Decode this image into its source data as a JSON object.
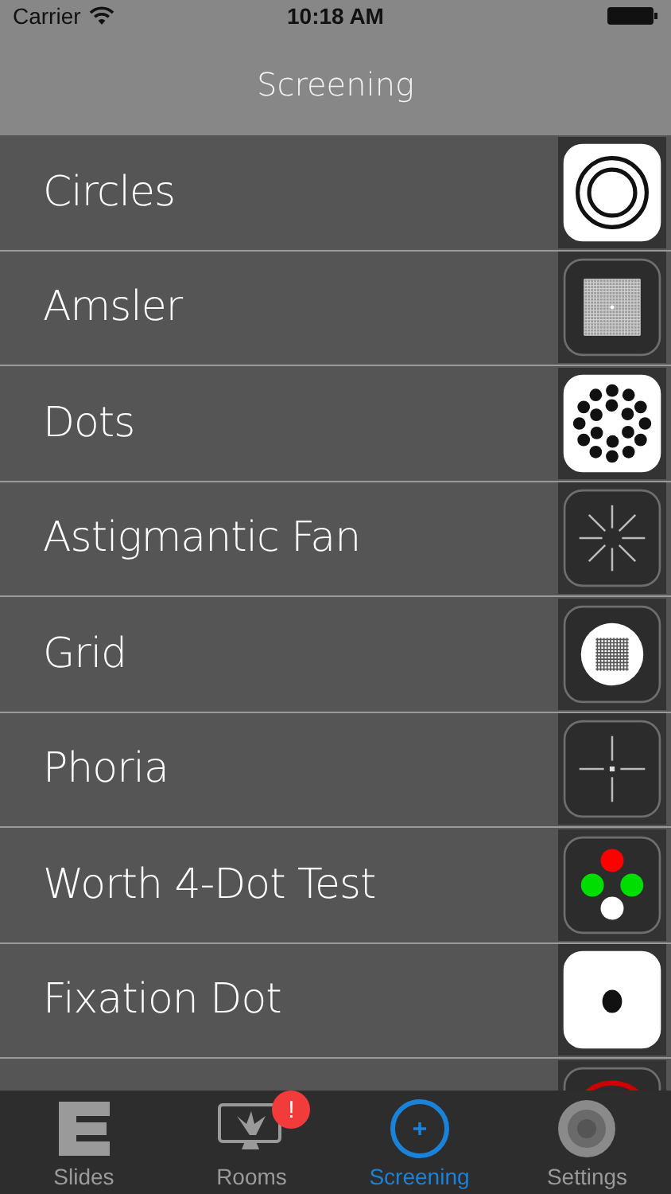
{
  "status_bar": {
    "carrier": "Carrier",
    "time": "10:18 AM"
  },
  "nav": {
    "title": "Screening"
  },
  "rows": [
    {
      "label": "Circles",
      "kind": "circles"
    },
    {
      "label": "Amsler",
      "kind": "amsler"
    },
    {
      "label": "Dots",
      "kind": "dots"
    },
    {
      "label": "Astigmantic Fan",
      "kind": "fan"
    },
    {
      "label": "Grid",
      "kind": "grid"
    },
    {
      "label": "Phoria",
      "kind": "phoria"
    },
    {
      "label": "Worth 4-Dot Test",
      "kind": "worth"
    },
    {
      "label": "Fixation Dot",
      "kind": "fixation"
    },
    {
      "kind": "rings"
    }
  ],
  "tabs": [
    {
      "label": "Slides",
      "kind": "slides",
      "selected": false
    },
    {
      "label": "Rooms",
      "kind": "monitor",
      "selected": false,
      "badge": "!"
    },
    {
      "label": "Screening",
      "kind": "plus",
      "selected": true
    },
    {
      "label": "Settings",
      "kind": "dial",
      "selected": false
    }
  ]
}
